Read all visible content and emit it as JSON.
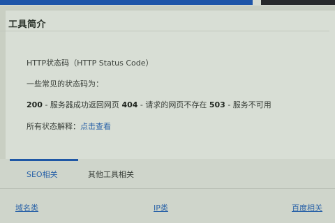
{
  "colors": {
    "accent": "#1e55a8",
    "link": "#2b63a8",
    "background": "#c9cfc3",
    "panel": "#d8ded5"
  },
  "panel": {
    "title": "工具简介",
    "intro": "HTTP状态码（HTTP Status Code）",
    "common_label": "一些常见的状态码为：",
    "codes": [
      {
        "code": "200",
        "desc": " - 服务器成功返回网页 "
      },
      {
        "code": "404",
        "desc": " - 请求的网页不存在 "
      },
      {
        "code": "503",
        "desc": " - 服务不可用"
      }
    ],
    "all_label": "所有状态解释：",
    "all_link": "点击查看"
  },
  "tabs": [
    {
      "label": "SEO相关",
      "active": true
    },
    {
      "label": "其他工具相关",
      "active": false
    }
  ],
  "categories": [
    "域名类",
    "IP类",
    "百度相关"
  ]
}
